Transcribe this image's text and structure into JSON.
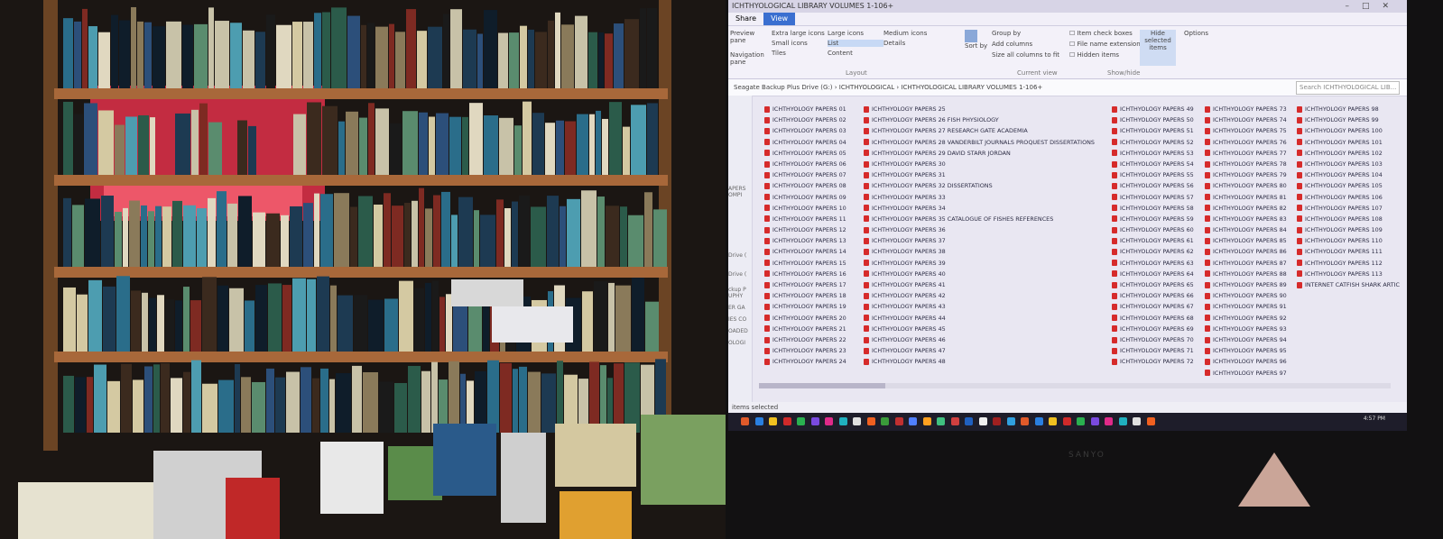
{
  "explorer": {
    "title": "ICHTHYOLOGICAL LIBRARY VOLUMES 1-106+",
    "tabs": [
      "Share",
      "View"
    ],
    "ribbon": {
      "layout": {
        "label": "Layout",
        "items": [
          "Extra large icons",
          "Large icons",
          "Medium icons",
          "Small icons",
          "List",
          "Details",
          "Tiles",
          "Content"
        ]
      },
      "current_view": {
        "label": "Current view",
        "sort": "Sort by",
        "items": [
          "Group by",
          "Add columns",
          "Size all columns to fit"
        ]
      },
      "show_hide": {
        "label": "Show/hide",
        "items": [
          "Item check boxes",
          "File name extensions",
          "Hidden items"
        ],
        "hide_selected": "Hide selected items",
        "options": "Options"
      },
      "nav_pane": "Navigation pane",
      "preview_pane": "Preview pane"
    },
    "address": [
      "Seagate Backup Plus Drive (G:)",
      "ICHTHYOLOGICAL",
      "ICHTHYOLOGICAL LIBRARY VOLUMES 1-106+"
    ],
    "search_placeholder": "Search ICHTHYOLOGICAL LIB...",
    "left_pane": [
      "APERS",
      "OMPI",
      "Drive (",
      "Drive (",
      "ckup P",
      "UPHY",
      "ER GA",
      "IES CO",
      "OADED",
      "OLOGI"
    ],
    "status": "items selected",
    "columns": [
      [
        "ICHTHYOLOGY PAPERS 01",
        "ICHTHYOLOGY PAPERS 02",
        "ICHTHYOLOGY PAPERS 03",
        "ICHTHYOLOGY PAPERS 04",
        "ICHTHYOLOGY PAPERS 05",
        "ICHTHYOLOGY PAPERS 06",
        "ICHTHYOLOGY PAPERS 07",
        "ICHTHYOLOGY PAPERS 08",
        "ICHTHYOLOGY PAPERS 09",
        "ICHTHYOLOGY PAPERS 10",
        "ICHTHYOLOGY PAPERS 11",
        "ICHTHYOLOGY PAPERS 12",
        "ICHTHYOLOGY PAPERS 13",
        "ICHTHYOLOGY PAPERS 14",
        "ICHTHYOLOGY PAPERS 15",
        "ICHTHYOLOGY PAPERS 16",
        "ICHTHYOLOGY PAPERS 17",
        "ICHTHYOLOGY PAPERS 18",
        "ICHTHYOLOGY PAPERS 19",
        "ICHTHYOLOGY PAPERS 20",
        "ICHTHYOLOGY PAPERS 21",
        "ICHTHYOLOGY PAPERS 22",
        "ICHTHYOLOGY PAPERS 23",
        "ICHTHYOLOGY PAPERS 24"
      ],
      [
        "ICHTHYOLOGY PAPERS 25",
        "ICHTHYOLOGY PAPERS 26 FISH PHYSIOLOGY",
        "ICHTHYOLOGY PAPERS 27 RESEARCH GATE ACADEMIA",
        "ICHTHYOLOGY PAPERS 28 VANDERBILT JOURNALS PROQUEST DISSERTATIONS",
        "ICHTHYOLOGY PAPERS 29 DAVID STARR JORDAN",
        "ICHTHYOLOGY PAPERS 30",
        "ICHTHYOLOGY PAPERS 31",
        "ICHTHYOLOGY PAPERS 32 DISSERTATIONS",
        "ICHTHYOLOGY PAPERS 33",
        "ICHTHYOLOGY PAPERS 34",
        "ICHTHYOLOGY PAPERS 35 CATALOGUE OF FISHES REFERENCES",
        "ICHTHYOLOGY PAPERS 36",
        "ICHTHYOLOGY PAPERS 37",
        "ICHTHYOLOGY PAPERS 38",
        "ICHTHYOLOGY PAPERS 39",
        "ICHTHYOLOGY PAPERS 40",
        "ICHTHYOLOGY PAPERS 41",
        "ICHTHYOLOGY PAPERS 42",
        "ICHTHYOLOGY PAPERS 43",
        "ICHTHYOLOGY PAPERS 44",
        "ICHTHYOLOGY PAPERS 45",
        "ICHTHYOLOGY PAPERS 46",
        "ICHTHYOLOGY PAPERS 47",
        "ICHTHYOLOGY PAPERS 48"
      ],
      [
        "ICHTHYOLOGY PAPERS 49",
        "ICHTHYOLOGY PAPERS 50",
        "ICHTHYOLOGY PAPERS 51",
        "ICHTHYOLOGY PAPERS 52",
        "ICHTHYOLOGY PAPERS 53",
        "ICHTHYOLOGY PAPERS 54",
        "ICHTHYOLOGY PAPERS 55",
        "ICHTHYOLOGY PAPERS 56",
        "ICHTHYOLOGY PAPERS 57",
        "ICHTHYOLOGY PAPERS 58",
        "ICHTHYOLOGY PAPERS 59",
        "ICHTHYOLOGY PAPERS 60",
        "ICHTHYOLOGY PAPERS 61",
        "ICHTHYOLOGY PAPERS 62",
        "ICHTHYOLOGY PAPERS 63",
        "ICHTHYOLOGY PAPERS 64",
        "ICHTHYOLOGY PAPERS 65",
        "ICHTHYOLOGY PAPERS 66",
        "ICHTHYOLOGY PAPERS 67",
        "ICHTHYOLOGY PAPERS 68",
        "ICHTHYOLOGY PAPERS 69",
        "ICHTHYOLOGY PAPERS 70",
        "ICHTHYOLOGY PAPERS 71",
        "ICHTHYOLOGY PAPERS 72"
      ],
      [
        "ICHTHYOLOGY PAPERS 73",
        "ICHTHYOLOGY PAPERS 74",
        "ICHTHYOLOGY PAPERS 75",
        "ICHTHYOLOGY PAPERS 76",
        "ICHTHYOLOGY PAPERS 77",
        "ICHTHYOLOGY PAPERS 78",
        "ICHTHYOLOGY PAPERS 79",
        "ICHTHYOLOGY PAPERS 80",
        "ICHTHYOLOGY PAPERS 81",
        "ICHTHYOLOGY PAPERS 82",
        "ICHTHYOLOGY PAPERS 83",
        "ICHTHYOLOGY PAPERS 84",
        "ICHTHYOLOGY PAPERS 85",
        "ICHTHYOLOGY PAPERS 86",
        "ICHTHYOLOGY PAPERS 87",
        "ICHTHYOLOGY PAPERS 88",
        "ICHTHYOLOGY PAPERS 89",
        "ICHTHYOLOGY PAPERS 90",
        "ICHTHYOLOGY PAPERS 91",
        "ICHTHYOLOGY PAPERS 92",
        "ICHTHYOLOGY PAPERS 93",
        "ICHTHYOLOGY PAPERS 94",
        "ICHTHYOLOGY PAPERS 95",
        "ICHTHYOLOGY PAPERS 96",
        "ICHTHYOLOGY PAPERS 97"
      ],
      [
        "ICHTHYOLOGY PAPERS 98",
        "ICHTHYOLOGY PAPERS 99",
        "ICHTHYOLOGY PAPERS 100",
        "ICHTHYOLOGY PAPERS 101",
        "ICHTHYOLOGY PAPERS 102",
        "ICHTHYOLOGY PAPERS 103",
        "ICHTHYOLOGY PAPERS 104",
        "ICHTHYOLOGY PAPERS 105",
        "ICHTHYOLOGY PAPERS 106",
        "ICHTHYOLOGY PAPERS 107",
        "ICHTHYOLOGY PAPERS 108",
        "ICHTHYOLOGY PAPERS 109",
        "ICHTHYOLOGY PAPERS 110",
        "ICHTHYOLOGY PAPERS 111",
        "ICHTHYOLOGY PAPERS 112",
        "ICHTHYOLOGY PAPERS 113",
        "INTERNET CATFISH SHARK ARTIC"
      ]
    ],
    "clock": "4:57 PM"
  },
  "monitor_brand": "SANYO",
  "shelves": {
    "wood": "#a8683a",
    "book_colors": [
      "#1d3a52",
      "#2a6d8a",
      "#0f1d2a",
      "#c8c2a8",
      "#5a8c6e",
      "#3b2a1e",
      "#e0d8c0",
      "#2c4f7a",
      "#7e2a22",
      "#1a1a1a",
      "#4d9db0",
      "#d4c9a2",
      "#2b5b4a",
      "#8a7a5a"
    ]
  }
}
